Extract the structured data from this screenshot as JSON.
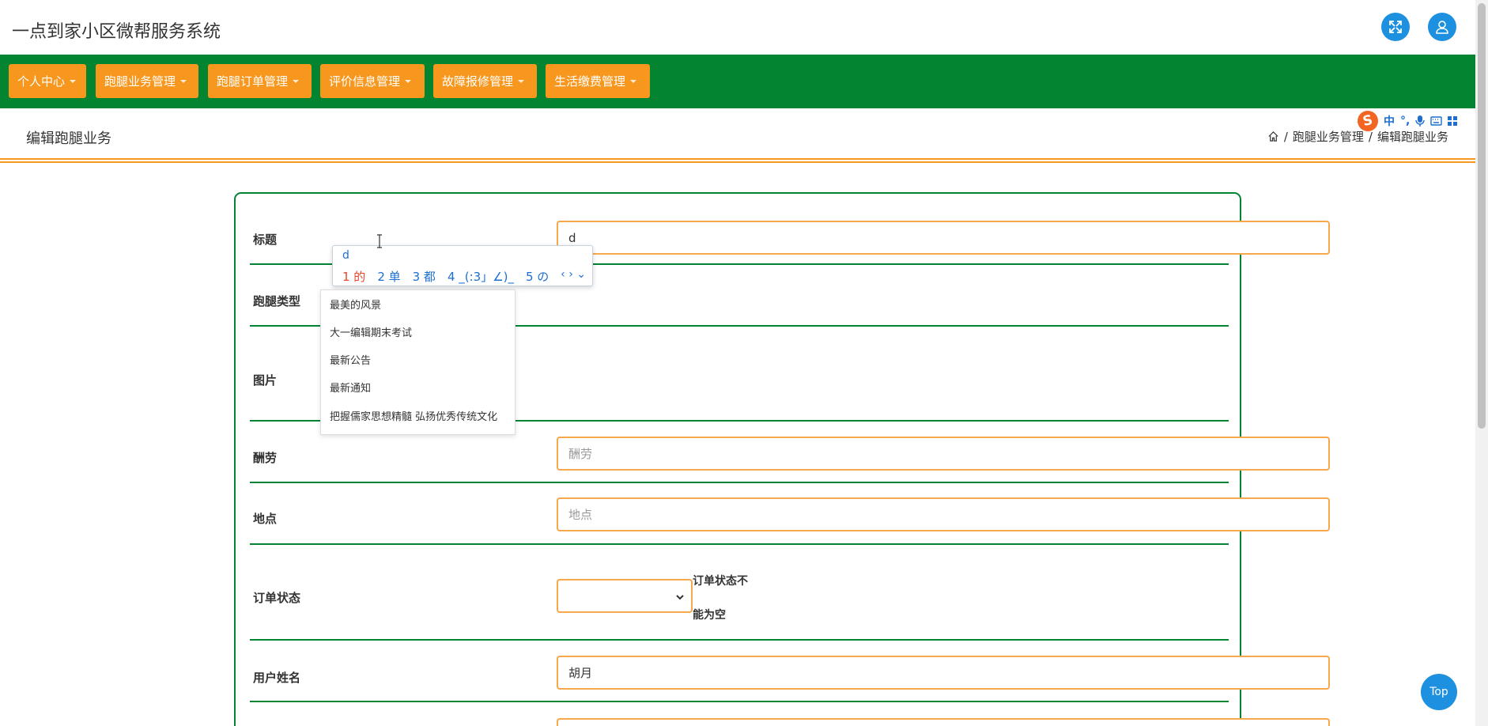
{
  "app": {
    "title": "一点到家小区微帮服务系统"
  },
  "header": {
    "fullscreen_icon": "expand-icon",
    "user_icon": "user-icon"
  },
  "nav": {
    "items": [
      {
        "label": "个人中心"
      },
      {
        "label": "跑腿业务管理"
      },
      {
        "label": "跑腿订单管理"
      },
      {
        "label": "评价信息管理"
      },
      {
        "label": "故障报修管理"
      },
      {
        "label": "生活缴费管理"
      }
    ]
  },
  "page": {
    "title": "编辑跑腿业务",
    "breadcrumb": {
      "home_icon": "home-icon",
      "sep": "/",
      "level1": "跑腿业务管理",
      "level2": "编辑跑腿业务"
    }
  },
  "form": {
    "title": {
      "label": "标题",
      "value": "d"
    },
    "type": {
      "label": "跑腿类型"
    },
    "image": {
      "label": "图片"
    },
    "reward": {
      "label": "酬劳",
      "placeholder": "酬劳"
    },
    "location": {
      "label": "地点",
      "placeholder": "地点"
    },
    "status": {
      "label": "订单状态",
      "value": "",
      "error_line1": "订单状态不",
      "error_line2": "能为空"
    },
    "username": {
      "label": "用户姓名",
      "value": "胡月"
    }
  },
  "ime": {
    "toolbar": {
      "logo": "S",
      "mode": "中",
      "punct": "°,",
      "mic_icon": "mic-icon",
      "keyboard_icon": "keyboard-icon",
      "grid_icon": "grid-icon"
    },
    "composition": "d",
    "candidates": [
      "1 的",
      "2 单",
      "3 都",
      "4 _(:3」∠)_",
      "5 の"
    ],
    "nav": "‹ › ⌄"
  },
  "history": {
    "items": [
      "最美的风景",
      "大一编辑期末考试",
      "最新公告",
      "最新通知",
      "把握儒家思想精髓 弘扬优秀传统文化"
    ]
  },
  "top_button": {
    "label": "Top"
  },
  "colors": {
    "nav_green": "#028431",
    "accent_orange": "#f7971e",
    "blue": "#1e90e0"
  }
}
